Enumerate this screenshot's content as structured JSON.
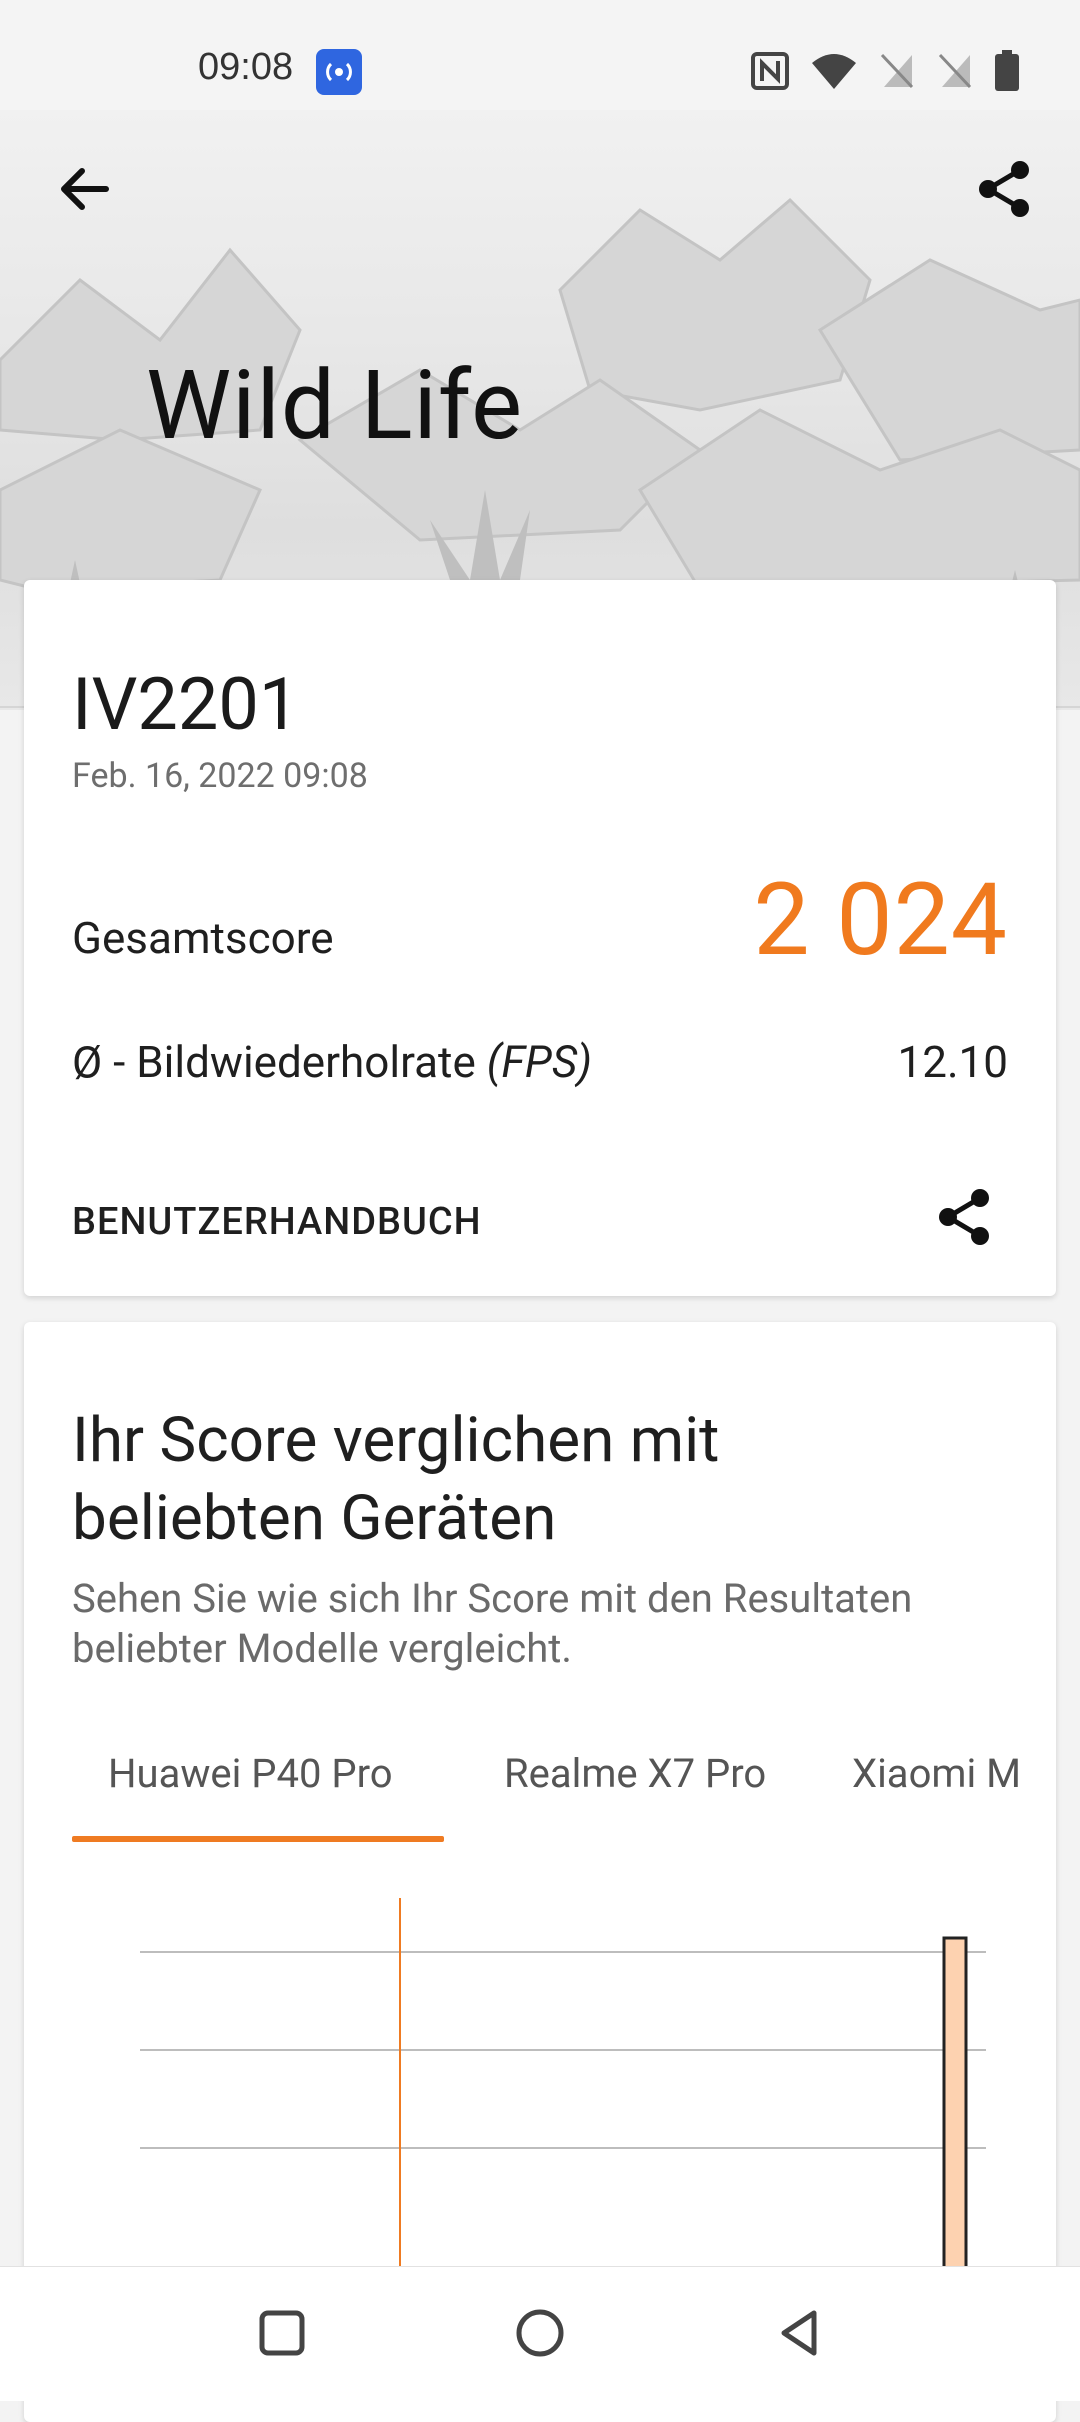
{
  "status_bar": {
    "time": "09:08",
    "icons": [
      "broadcast-app-icon",
      "nfc-icon",
      "wifi-icon",
      "sim-off-icon",
      "sim-off-icon",
      "battery-icon"
    ]
  },
  "header": {
    "title": "Wild Life",
    "back_icon": "arrow-left-icon",
    "share_icon": "share-icon"
  },
  "result": {
    "device": "IV2201",
    "date": "Feb. 16, 2022 09:08",
    "total_label": "Gesamtscore",
    "total_score": "2 024",
    "fps_label_prefix": "Ø - Bildwiederholrate ",
    "fps_label_unit": "(FPS)",
    "fps_value": "12.10",
    "manual_label": "BENUTZERHANDBUCH",
    "accent_color": "#f07a1e"
  },
  "comparison": {
    "title": "Ihr Score verglichen mit beliebten Geräten",
    "subtitle": "Sehen Sie wie sich Ihr Score mit den Resultaten beliebter Modelle vergleicht.",
    "tabs": [
      {
        "label": "Huawei P40 Pro",
        "active": true
      },
      {
        "label": "Realme X7 Pro",
        "active": false
      },
      {
        "label": "Xiaomi M",
        "active": false
      }
    ]
  },
  "chart_data": {
    "type": "bar",
    "title": "",
    "xlabel": "",
    "ylabel": "",
    "grid": true,
    "marker_line_color": "#ef7b22",
    "bar_color": "#fdd2b0",
    "bar_stroke": "#222222",
    "partial_view": true
  },
  "nav_bar": {
    "buttons": [
      "recent-apps-icon",
      "home-icon",
      "back-triangle-icon"
    ]
  }
}
